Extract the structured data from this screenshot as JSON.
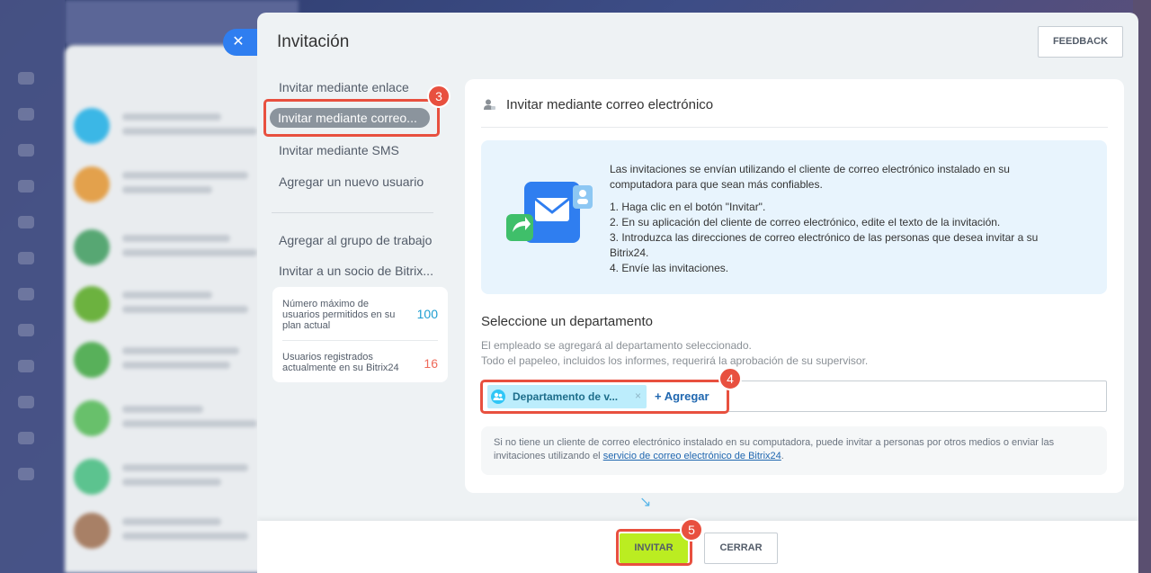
{
  "window": {
    "title": "Invitación",
    "feedback_label": "FEEDBACK",
    "close_icon": "✕"
  },
  "sidebar": {
    "items": [
      {
        "label": "Invitar mediante enlace"
      },
      {
        "label": "Invitar mediante correo..."
      },
      {
        "label": "Invitar mediante SMS"
      },
      {
        "label": "Agregar un nuevo usuario"
      },
      {
        "label": "Agregar al grupo de trabajo"
      },
      {
        "label": "Invitar a un socio de Bitrix..."
      }
    ],
    "active_index": 1
  },
  "stats": {
    "max_users_label": "Número máximo de usuarios permitidos en su plan actual",
    "max_users_value": "100",
    "registered_label": "Usuarios registrados actualmente en su Bitrix24",
    "registered_value": "16",
    "max_color": "#1e9ed1",
    "registered_color": "#ef6a5a"
  },
  "main": {
    "title": "Invitar mediante correo electrónico",
    "info": {
      "intro": "Las invitaciones se envían utilizando el cliente de correo electrónico instalado en su computadora para que sean más confiables.",
      "step1": "1. Haga clic en el botón \"Invitar\".",
      "step2": "2. En su aplicación del cliente de correo electrónico, edite el texto de la invitación.",
      "step3": "3. Introduzca las direcciones de correo electrónico de las personas que desea invitar a su Bitrix24.",
      "step4": "4. Envíe las invitaciones."
    },
    "department": {
      "title": "Seleccione un departamento",
      "desc1": "El empleado se agregará al departamento seleccionado.",
      "desc2": "Todo el papeleo, incluidos los informes, requerirá la aprobación de su supervisor.",
      "chip_label": "Departamento de v...",
      "chip_remove": "×",
      "add_label": "+ Agregar"
    },
    "hint": {
      "text": "Si no tiene un cliente de correo electrónico instalado en su computadora, puede invitar a personas por otros medios o enviar las invitaciones utilizando el ",
      "link": "servicio de correo electrónico de Bitrix24",
      "tail": "."
    }
  },
  "footer": {
    "invite_label": "INVITAR",
    "close_label": "CERRAR"
  },
  "annotations": {
    "badge3": "3",
    "badge4": "4",
    "badge5": "5",
    "arrow": "↘"
  },
  "colors": {
    "accent": "#2f7ef0",
    "invite_button": "#bbed21",
    "highlight": "#e8503f"
  }
}
